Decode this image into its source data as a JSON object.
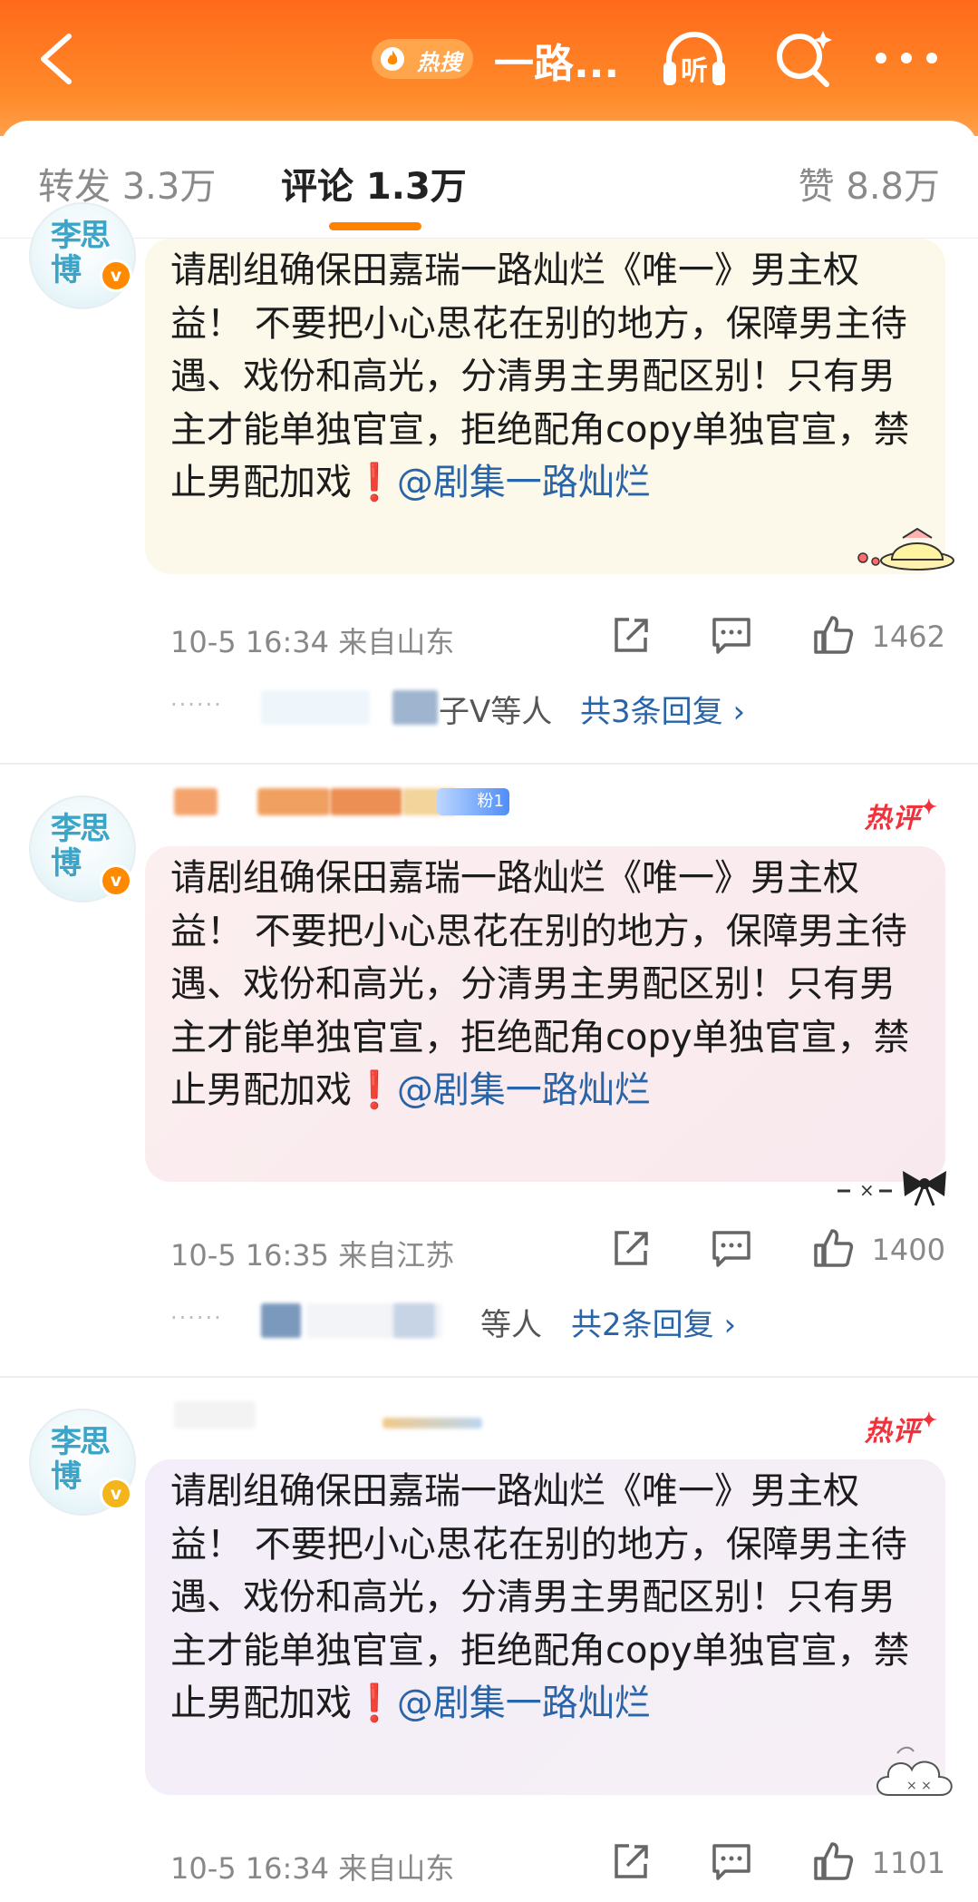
{
  "header": {
    "hot_label": "热搜",
    "title": "一路...",
    "listen_label": "听",
    "icons": [
      "back-arrow-icon",
      "flame-icon",
      "headphones-icon",
      "search-icon",
      "more-dots-icon"
    ],
    "gradient_colors": [
      "#ff6a1a",
      "#ffa04a"
    ]
  },
  "tabs": {
    "repost": "转发 3.3万",
    "comment": "评论 1.3万",
    "like": "赞 8.8万",
    "active_color": "#ff8200"
  },
  "avatar_text": "李思博",
  "comments": [
    {
      "text_main": "请剧组确保田嘉瑞一路灿烂《唯一》男主权益！ 不要把小心思花在别的地方，保障男主待遇、戏份和高光，分清男主男配区别！只有男主才能单独官宣，拒绝配角copy单独官宣，禁止男配加戏",
      "warn": "❗",
      "mention": "@剧集一路灿烂",
      "time": "10-5 16:34",
      "location": "来自山东",
      "likes": "1462",
      "reply_dots": "······",
      "reply_names": "子V等人",
      "reply_link": "共3条回复 ›"
    },
    {
      "hot_tag": "热评",
      "fan_badge": "粉1",
      "text_main": "请剧组确保田嘉瑞一路灿烂《唯一》男主权益！ 不要把小心思花在别的地方，保障男主待遇、戏份和高光，分清男主男配区别！只有男主才能单独官宣，拒绝配角copy单独官宣，禁止男配加戏",
      "warn": "❗",
      "mention": "@剧集一路灿烂",
      "time": "10-5 16:35",
      "location": "来自江苏",
      "likes": "1400",
      "reply_dots": "······",
      "reply_names": "等人",
      "reply_link": "共2条回复 ›"
    },
    {
      "hot_tag": "热评",
      "text_main": "请剧组确保田嘉瑞一路灿烂《唯一》男主权益！ 不要把小心思花在别的地方，保障男主待遇、戏份和高光，分清男主男配区别！只有男主才能单独官宣，拒绝配角copy单独官宣，禁止男配加戏",
      "warn": "❗",
      "mention": "@剧集一路灿烂",
      "time": "10-5 16:34",
      "location": "来自山东",
      "likes": "1101"
    }
  ]
}
